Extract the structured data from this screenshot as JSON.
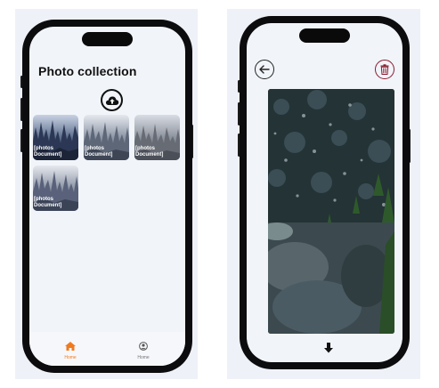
{
  "gallery_screen": {
    "title": "Photo collection",
    "upload_icon": "cloud-upload-icon",
    "photos": [
      {
        "caption_line1": "[photos",
        "caption_line2": "Document]"
      },
      {
        "caption_line1": "[photos",
        "caption_line2": "Document]"
      },
      {
        "caption_line1": "[photos",
        "caption_line2": "Document]"
      },
      {
        "caption_line1": "[photos",
        "caption_line2": "Document]"
      }
    ],
    "tabs": [
      {
        "label": "Home",
        "icon": "home-icon",
        "active": true,
        "color": "#f07b1f"
      },
      {
        "label": "Home",
        "icon": "user-icon",
        "active": false,
        "color": "#777777"
      }
    ]
  },
  "detail_screen": {
    "back_icon": "arrow-left-icon",
    "delete_icon": "trash-icon",
    "delete_color": "#8b1a2b",
    "download_icon": "arrow-down-icon"
  }
}
